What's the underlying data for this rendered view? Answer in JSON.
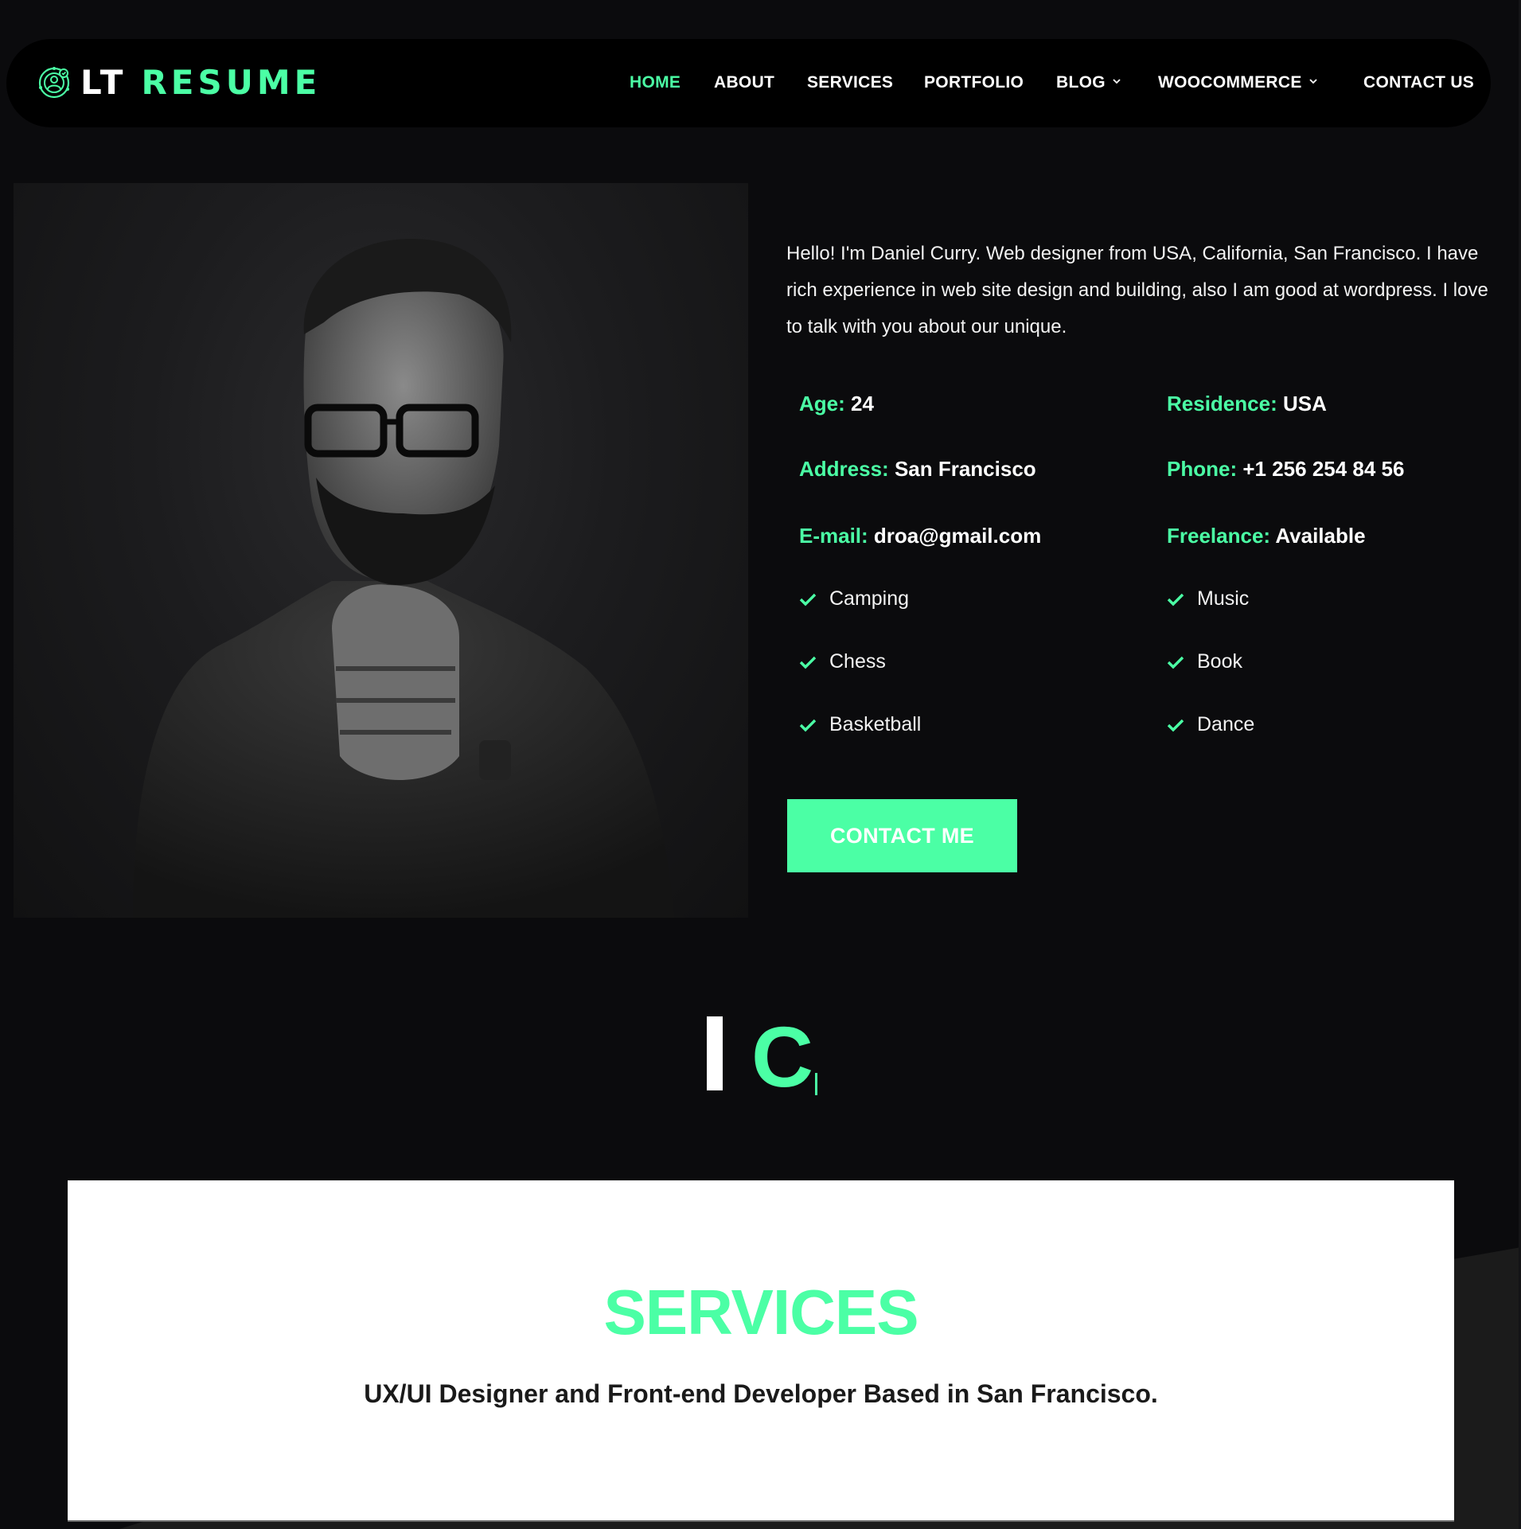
{
  "theme": {
    "accent": "#4bffa5",
    "background": "#0b0b0d",
    "header_bg": "#000000"
  },
  "header": {
    "logo": {
      "icon": "profile-orbit-icon",
      "part1": "LT",
      "part2": "RESUME"
    },
    "nav": [
      {
        "label": "HOME",
        "active": true,
        "dropdown": false
      },
      {
        "label": "ABOUT",
        "active": false,
        "dropdown": false
      },
      {
        "label": "SERVICES",
        "active": false,
        "dropdown": false
      },
      {
        "label": "PORTFOLIO",
        "active": false,
        "dropdown": false
      },
      {
        "label": "BLOG",
        "active": false,
        "dropdown": true
      },
      {
        "label": "WOOCOMMERCE",
        "active": false,
        "dropdown": true
      },
      {
        "label": "CONTACT US",
        "active": false,
        "dropdown": false
      }
    ]
  },
  "hero": {
    "photo_alt": "Black and white portrait of Daniel Curry",
    "bio": "Hello! I'm Daniel Curry. Web designer from USA, California, San Francisco. I have rich experience in web site design and building, also I am good at wordpress. I love to talk with you about our unique.",
    "info": [
      {
        "label": "Age:",
        "value": "24"
      },
      {
        "label": "Residence:",
        "value": "USA"
      },
      {
        "label": "Address:",
        "value": "San Francisco"
      },
      {
        "label": "Phone:",
        "value": "+1 256 254 84 56"
      },
      {
        "label": "E-mail:",
        "value": "droa@gmail.com"
      },
      {
        "label": "Freelance:",
        "value": "Available"
      }
    ],
    "hobbies": [
      "Camping",
      "Music",
      "Chess",
      "Book",
      "Basketball",
      "Dance"
    ],
    "cta_label": "CONTACT ME"
  },
  "typewriter": {
    "word1": "I",
    "word2": "C"
  },
  "services": {
    "title": "SERVICES",
    "subtitle": "UX/UI Designer and Front-end Developer Based in San Francisco."
  }
}
